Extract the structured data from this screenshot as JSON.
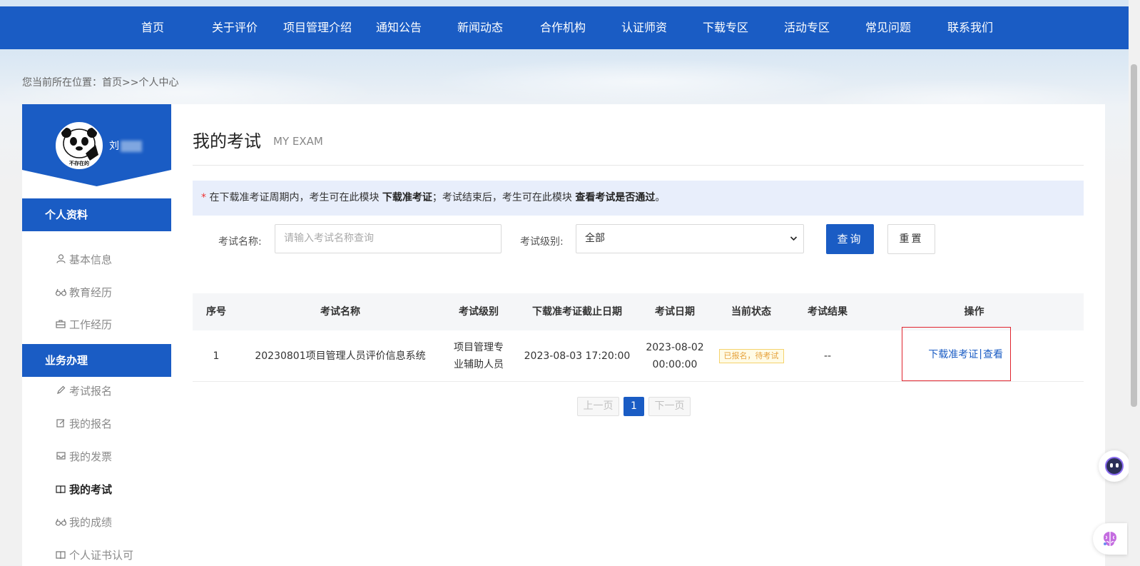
{
  "nav": [
    "首页",
    "关于评价",
    "项目管理介绍",
    "通知公告",
    "新闻动态",
    "合作机构",
    "认证师资",
    "下载专区",
    "活动专区",
    "常见问题",
    "联系我们"
  ],
  "breadcrumb": {
    "prefix": "您当前所在位置：",
    "home": "首页",
    "sep": ">>",
    "current": "个人中心"
  },
  "profile": {
    "name_visible": "刘",
    "avatar_caption": "不存在的"
  },
  "sidebar": {
    "section_personal": "个人资料",
    "personal_items": [
      {
        "label": "基本信息",
        "icon": "user-icon"
      },
      {
        "label": "教育经历",
        "icon": "glasses-icon"
      },
      {
        "label": "工作经历",
        "icon": "briefcase-icon"
      }
    ],
    "section_business": "业务办理",
    "business_items": [
      {
        "label": "考试报名",
        "icon": "pencil-icon"
      },
      {
        "label": "我的报名",
        "icon": "edit-icon"
      },
      {
        "label": "我的发票",
        "icon": "inbox-icon"
      },
      {
        "label": "我的考试",
        "icon": "book-icon",
        "active": true
      },
      {
        "label": "我的成绩",
        "icon": "glasses-icon"
      },
      {
        "label": "个人证书认可",
        "icon": "book-icon"
      }
    ]
  },
  "main": {
    "title": "我的考试",
    "subtitle": "MY EXAM",
    "notice": {
      "star": "*",
      "part1": " 在下载准考证周期内，考生可在此模块 ",
      "bold1": "下载准考证",
      "part2": "；考试结束后，考生可在此模块 ",
      "bold2": "查看考试是否通过",
      "part3": "。"
    },
    "filters": {
      "name_label": "考试名称:",
      "name_placeholder": "请输入考试名称查询",
      "level_label": "考试级别:",
      "level_value": "全部",
      "query_button": "查询",
      "reset_button": "重置"
    },
    "table": {
      "headers": [
        "序号",
        "考试名称",
        "考试级别",
        "下载准考证截止日期",
        "考试日期",
        "当前状态",
        "考试结果",
        "操作"
      ],
      "rows": [
        {
          "index": "1",
          "name": "20230801项目管理人员评价信息系统",
          "level_line1": "项目管理专",
          "level_line2": "业辅助人员",
          "deadline": "2023-08-03 17:20:00",
          "date_line1": "2023-08-02",
          "date_line2": "00:00:00",
          "status": "已报名，待考试",
          "result": "--",
          "action_download": "下载准考证",
          "action_sep": "|",
          "action_view": "查看"
        }
      ]
    },
    "pagination": {
      "prev": "上一页",
      "current": "1",
      "next": "下一页"
    }
  },
  "colors": {
    "primary": "#1a5cc4",
    "highlight_border": "#e0242e",
    "status_badge": "#e6a23c"
  }
}
